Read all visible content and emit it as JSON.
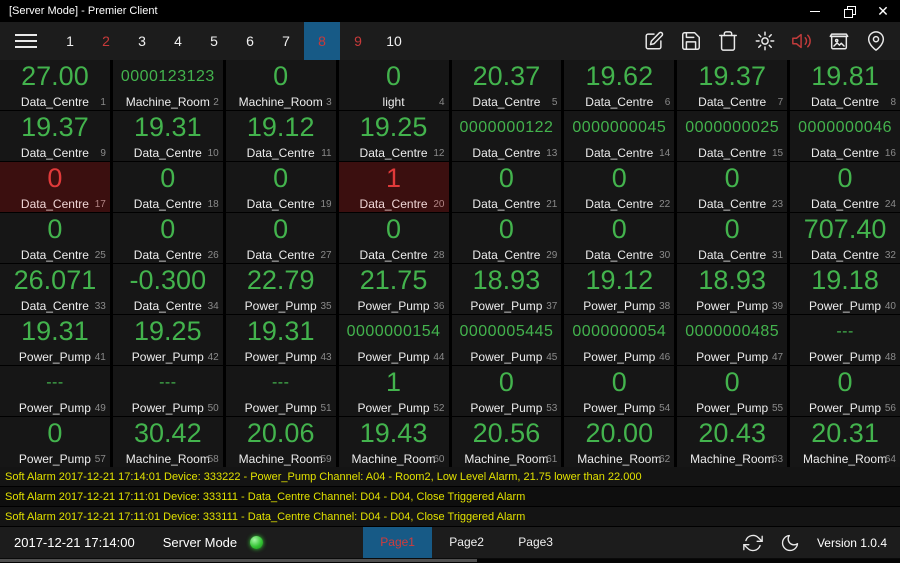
{
  "titlebar": {
    "title": "[Server Mode] - Premier Client"
  },
  "toolbar": {
    "pages": [
      {
        "label": "1",
        "red": false,
        "selected": false
      },
      {
        "label": "2",
        "red": true,
        "selected": false
      },
      {
        "label": "3",
        "red": false,
        "selected": false
      },
      {
        "label": "4",
        "red": false,
        "selected": false
      },
      {
        "label": "5",
        "red": false,
        "selected": false
      },
      {
        "label": "6",
        "red": false,
        "selected": false
      },
      {
        "label": "7",
        "red": false,
        "selected": false
      },
      {
        "label": "8",
        "red": true,
        "selected": true
      },
      {
        "label": "9",
        "red": true,
        "selected": false
      },
      {
        "label": "10",
        "red": false,
        "selected": false
      }
    ],
    "icons": [
      "menu-icon",
      "edit-icon",
      "save-icon",
      "trash-icon",
      "gear-icon",
      "speaker-icon",
      "snapshot-box-icon",
      "map-pin-icon"
    ]
  },
  "colors": {
    "value_green": "#43b34d",
    "alarm_red": "#e03a3a",
    "alarm_cell_bg": "#3b0f0f",
    "alarm_text_yellow": "#e1e100",
    "selected_blue": "#175a86",
    "toolbar_red": "#c73a3a"
  },
  "grid": {
    "cells": [
      {
        "value": "27.00",
        "label": "Data_Centre",
        "index": "1"
      },
      {
        "value": "0000123123",
        "label": "Machine_Room",
        "index": "2",
        "small": true
      },
      {
        "value": "0",
        "label": "Machine_Room",
        "index": "3"
      },
      {
        "value": "0",
        "label": "light",
        "index": "4"
      },
      {
        "value": "20.37",
        "label": "Data_Centre",
        "index": "5"
      },
      {
        "value": "19.62",
        "label": "Data_Centre",
        "index": "6"
      },
      {
        "value": "19.37",
        "label": "Data_Centre",
        "index": "7"
      },
      {
        "value": "19.81",
        "label": "Data_Centre",
        "index": "8"
      },
      {
        "value": "19.37",
        "label": "Data_Centre",
        "index": "9"
      },
      {
        "value": "19.31",
        "label": "Data_Centre",
        "index": "10"
      },
      {
        "value": "19.12",
        "label": "Data_Centre",
        "index": "11"
      },
      {
        "value": "19.25",
        "label": "Data_Centre",
        "index": "12"
      },
      {
        "value": "0000000122",
        "label": "Data_Centre",
        "index": "13",
        "small": true
      },
      {
        "value": "0000000045",
        "label": "Data_Centre",
        "index": "14",
        "small": true
      },
      {
        "value": "0000000025",
        "label": "Data_Centre",
        "index": "15",
        "small": true
      },
      {
        "value": "0000000046",
        "label": "Data_Centre",
        "index": "16",
        "small": true
      },
      {
        "value": "0",
        "label": "Data_Centre",
        "index": "17",
        "alarm": true
      },
      {
        "value": "0",
        "label": "Data_Centre",
        "index": "18"
      },
      {
        "value": "0",
        "label": "Data_Centre",
        "index": "19"
      },
      {
        "value": "1",
        "label": "Data_Centre",
        "index": "20",
        "alarm": true
      },
      {
        "value": "0",
        "label": "Data_Centre",
        "index": "21"
      },
      {
        "value": "0",
        "label": "Data_Centre",
        "index": "22"
      },
      {
        "value": "0",
        "label": "Data_Centre",
        "index": "23"
      },
      {
        "value": "0",
        "label": "Data_Centre",
        "index": "24"
      },
      {
        "value": "0",
        "label": "Data_Centre",
        "index": "25"
      },
      {
        "value": "0",
        "label": "Data_Centre",
        "index": "26"
      },
      {
        "value": "0",
        "label": "Data_Centre",
        "index": "27"
      },
      {
        "value": "0",
        "label": "Data_Centre",
        "index": "28"
      },
      {
        "value": "0",
        "label": "Data_Centre",
        "index": "29"
      },
      {
        "value": "0",
        "label": "Data_Centre",
        "index": "30"
      },
      {
        "value": "0",
        "label": "Data_Centre",
        "index": "31"
      },
      {
        "value": "707.40",
        "label": "Data_Centre",
        "index": "32"
      },
      {
        "value": "26.071",
        "label": "Data_Centre",
        "index": "33"
      },
      {
        "value": "-0.300",
        "label": "Data_Centre",
        "index": "34"
      },
      {
        "value": "22.79",
        "label": "Power_Pump",
        "index": "35"
      },
      {
        "value": "21.75",
        "label": "Power_Pump",
        "index": "36"
      },
      {
        "value": "18.93",
        "label": "Power_Pump",
        "index": "37"
      },
      {
        "value": "19.12",
        "label": "Power_Pump",
        "index": "38"
      },
      {
        "value": "18.93",
        "label": "Power_Pump",
        "index": "39"
      },
      {
        "value": "19.18",
        "label": "Power_Pump",
        "index": "40"
      },
      {
        "value": "19.31",
        "label": "Power_Pump",
        "index": "41"
      },
      {
        "value": "19.25",
        "label": "Power_Pump",
        "index": "42"
      },
      {
        "value": "19.31",
        "label": "Power_Pump",
        "index": "43"
      },
      {
        "value": "0000000154",
        "label": "Power_Pump",
        "index": "44",
        "small": true
      },
      {
        "value": "0000005445",
        "label": "Power_Pump",
        "index": "45",
        "small": true
      },
      {
        "value": "0000000054",
        "label": "Power_Pump",
        "index": "46",
        "small": true
      },
      {
        "value": "0000000485",
        "label": "Power_Pump",
        "index": "47",
        "small": true
      },
      {
        "value": "---",
        "label": "Power_Pump",
        "index": "48",
        "small": true
      },
      {
        "value": "---",
        "label": "Power_Pump",
        "index": "49",
        "small": true
      },
      {
        "value": "---",
        "label": "Power_Pump",
        "index": "50",
        "small": true
      },
      {
        "value": "---",
        "label": "Power_Pump",
        "index": "51",
        "small": true
      },
      {
        "value": "1",
        "label": "Power_Pump",
        "index": "52"
      },
      {
        "value": "0",
        "label": "Power_Pump",
        "index": "53"
      },
      {
        "value": "0",
        "label": "Power_Pump",
        "index": "54"
      },
      {
        "value": "0",
        "label": "Power_Pump",
        "index": "55"
      },
      {
        "value": "0",
        "label": "Power_Pump",
        "index": "56"
      },
      {
        "value": "0",
        "label": "Power_Pump",
        "index": "57"
      },
      {
        "value": "30.42",
        "label": "Machine_Room",
        "index": "58"
      },
      {
        "value": "20.06",
        "label": "Machine_Room",
        "index": "59"
      },
      {
        "value": "19.43",
        "label": "Machine_Room",
        "index": "60"
      },
      {
        "value": "20.56",
        "label": "Machine_Room",
        "index": "61"
      },
      {
        "value": "20.00",
        "label": "Machine_Room",
        "index": "62"
      },
      {
        "value": "20.43",
        "label": "Machine_Room",
        "index": "63"
      },
      {
        "value": "20.31",
        "label": "Machine_Room",
        "index": "64"
      }
    ]
  },
  "alarms": [
    "Soft Alarm 2017-12-21 17:14:01 Device: 333222 - Power_Pump Channel: A04 - Room2, Low Level Alarm, 21.75 lower than 22.000",
    "Soft Alarm 2017-12-21 17:11:01 Device: 333111 - Data_Centre Channel: D04 - D04, Close Triggered Alarm",
    "Soft Alarm 2017-12-21 17:11:01 Device: 333111 - Data_Centre Channel: D04 - D04, Close Triggered Alarm"
  ],
  "statusbar": {
    "time": "2017-12-21 17:14:00",
    "mode_label": "Server Mode",
    "tabs": [
      {
        "label": "Page1",
        "selected": true
      },
      {
        "label": "Page2",
        "selected": false
      },
      {
        "label": "Page3",
        "selected": false
      }
    ],
    "version": "Version 1.0.4"
  }
}
